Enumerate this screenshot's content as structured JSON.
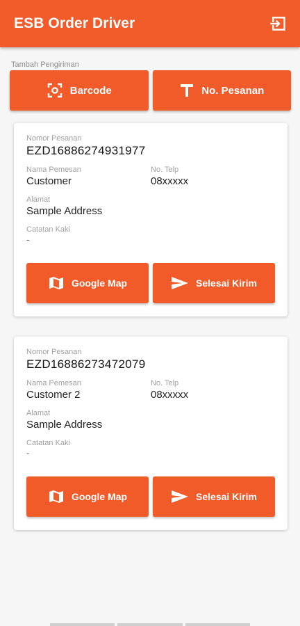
{
  "app": {
    "title": "ESB Order Driver",
    "accent_color": "#f15a29"
  },
  "header": {
    "logout_icon": "logout-icon"
  },
  "add_shipment": {
    "label": "Tambah Pengiriman",
    "barcode_label": "Barcode",
    "barcode_icon": "barcode-scan-icon",
    "order_no_label": "No. Pesanan",
    "order_no_icon": "text-t-icon"
  },
  "orders": [
    {
      "order_no_label": "Nomor Pesanan",
      "order_no": "EZD16886274931977",
      "customer_label": "Nama Pemesan",
      "customer": "Customer",
      "phone_label": "No. Telp",
      "phone": "08xxxxx",
      "address_label": "Alamat",
      "address": "Sample Address",
      "note_label": "Catatan Kaki",
      "note": "-",
      "map_button": "Google Map",
      "done_button": "Selesai Kirim"
    },
    {
      "order_no_label": "Nomor Pesanan",
      "order_no": "EZD16886273472079",
      "customer_label": "Nama Pemesan",
      "customer": "Customer 2",
      "phone_label": "No. Telp",
      "phone": "08xxxxx",
      "address_label": "Alamat",
      "address": "Sample Address",
      "note_label": "Catatan Kaki",
      "note": "-",
      "map_button": "Google Map",
      "done_button": "Selesai Kirim"
    }
  ]
}
